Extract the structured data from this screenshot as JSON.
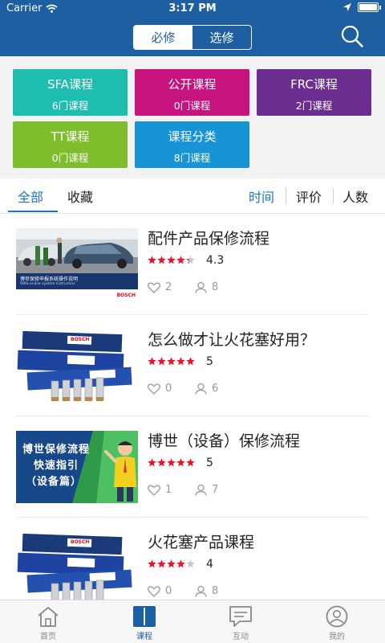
{
  "status_bar": {
    "carrier": "Carrier",
    "time": "3:17 PM"
  },
  "header": {
    "segments": [
      "必修",
      "选修"
    ],
    "active_segment": "必修",
    "icons": {
      "search": "search-icon"
    },
    "colors": {
      "background": "#1d5fa0",
      "active_text": "#1d5fa0"
    }
  },
  "categories": [
    {
      "name": "SFA课程",
      "count": "6门课程",
      "color": "#1fbcb0"
    },
    {
      "name": "公开课程",
      "count": "0门课程",
      "color": "#c7137e"
    },
    {
      "name": "FRC课程",
      "count": "2门课程",
      "color": "#6b2e90"
    },
    {
      "name": "TT课程",
      "count": "0门课程",
      "color": "#7ebe2c"
    },
    {
      "name": "课程分类",
      "count": "8门课程",
      "color": "#1694d6"
    }
  ],
  "filter": {
    "tabs": [
      "全部",
      "收藏"
    ],
    "active_tab": "全部",
    "sort": [
      "时间",
      "评价",
      "人数"
    ],
    "active_sort": "时间",
    "accent": "#1d73c4"
  },
  "courses": [
    {
      "title": "配件产品保修流程",
      "rating": 4.3,
      "score": "4.3",
      "likes": "2",
      "learners": "8",
      "thumb": {
        "type": "workshop",
        "caption": "博世保修申报系统操作说明",
        "subcaption": "RWS-online system instruction",
        "brand": "BOSCH"
      }
    },
    {
      "title": "怎么做才让火花塞好用？",
      "rating": 5,
      "score": "5",
      "likes": "0",
      "learners": "6",
      "thumb": {
        "type": "sparkplug",
        "brand": "BOSCH"
      }
    },
    {
      "title": "博世（设备）保修流程",
      "rating": 5,
      "score": "5",
      "likes": "1",
      "learners": "7",
      "thumb": {
        "type": "guide",
        "lines": [
          "博世保修流程",
          "快速指引",
          "（设备篇）"
        ]
      }
    },
    {
      "title": "火花塞产品课程",
      "rating": 4,
      "score": "4",
      "likes": "0",
      "learners": "8",
      "thumb": {
        "type": "sparkplug",
        "brand": "BOSCH"
      }
    }
  ],
  "rating_color": "#e8142a",
  "tabbar": [
    {
      "label": "首页",
      "icon": "home-icon"
    },
    {
      "label": "课程",
      "icon": "book-icon",
      "active": true
    },
    {
      "label": "互动",
      "icon": "chat-icon"
    },
    {
      "label": "我的",
      "icon": "profile-icon"
    }
  ],
  "tab_active_color": "#1d5fa0"
}
